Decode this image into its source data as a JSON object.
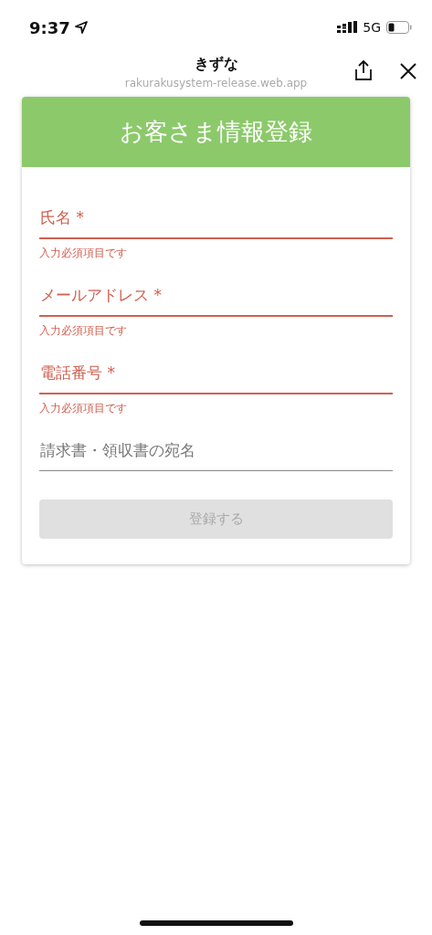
{
  "status_bar": {
    "time": "9:37",
    "network": "5G"
  },
  "browser_header": {
    "title": "きずな",
    "url": "rakurakusystem-release.web.app"
  },
  "form": {
    "title": "お客さま情報登録",
    "fields": [
      {
        "label": "氏名 *",
        "invalid": true,
        "error": "入力必須項目です"
      },
      {
        "label": "メールアドレス *",
        "invalid": true,
        "error": "入力必須項目です"
      },
      {
        "label": "電話番号 *",
        "invalid": true,
        "error": "入力必須項目です"
      },
      {
        "label": "請求書・領収書の宛名",
        "invalid": false
      }
    ],
    "submit": {
      "label": "登録する",
      "disabled": true
    }
  }
}
